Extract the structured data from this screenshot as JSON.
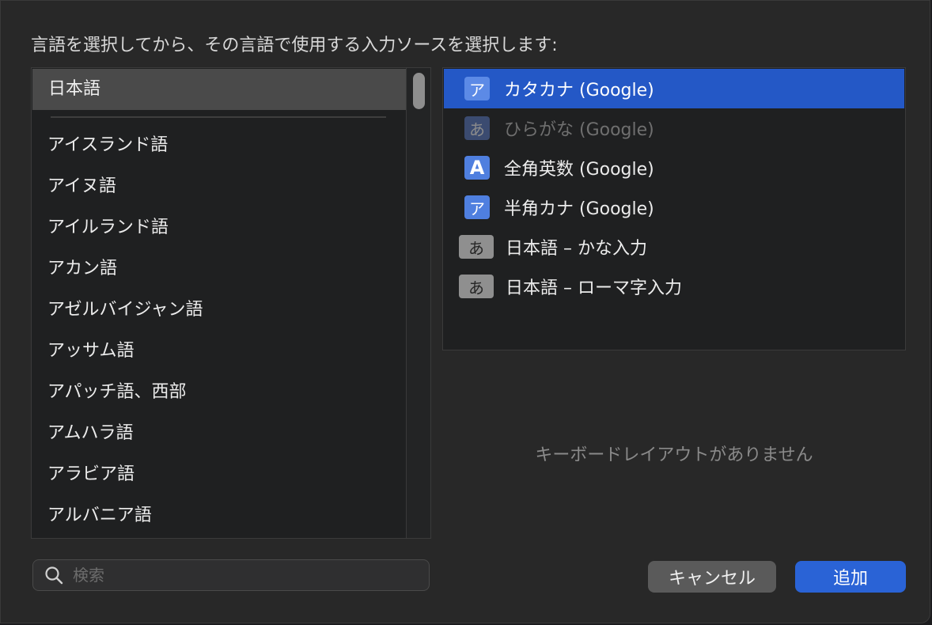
{
  "dialog": {
    "prompt": "言語を選択してから、その言語で使用する入力ソースを選択します:"
  },
  "languages": {
    "selected": "日本語",
    "items": [
      "アイスランド語",
      "アイヌ語",
      "アイルランド語",
      "アカン語",
      "アゼルバイジャン語",
      "アッサム語",
      "アパッチ語、西部",
      "アムハラ語",
      "アラビア語",
      "アルバニア語"
    ]
  },
  "sources": {
    "items": [
      {
        "icon": "ア",
        "icon_name": "katakana-icon",
        "label": "カタカナ (Google)"
      },
      {
        "icon": "あ",
        "icon_name": "hiragana-icon",
        "label": "ひらがな (Google)"
      },
      {
        "icon": "A",
        "icon_name": "fullwidth-alpha-icon",
        "label": "全角英数 (Google)"
      },
      {
        "icon": "ア",
        "icon_name": "halfwidth-kana-icon",
        "label": "半角カナ (Google)"
      },
      {
        "icon": "あ",
        "icon_name": "kana-input-icon",
        "label": "日本語 – かな入力"
      },
      {
        "icon": "あ",
        "icon_name": "romaji-input-icon",
        "label": "日本語 – ローマ字入力"
      }
    ],
    "no_layout": "キーボードレイアウトがありません"
  },
  "search": {
    "placeholder": "検索"
  },
  "buttons": {
    "cancel": "キャンセル",
    "add": "追加"
  },
  "colors": {
    "accent": "#2458c6",
    "add_button": "#2a63d6"
  }
}
